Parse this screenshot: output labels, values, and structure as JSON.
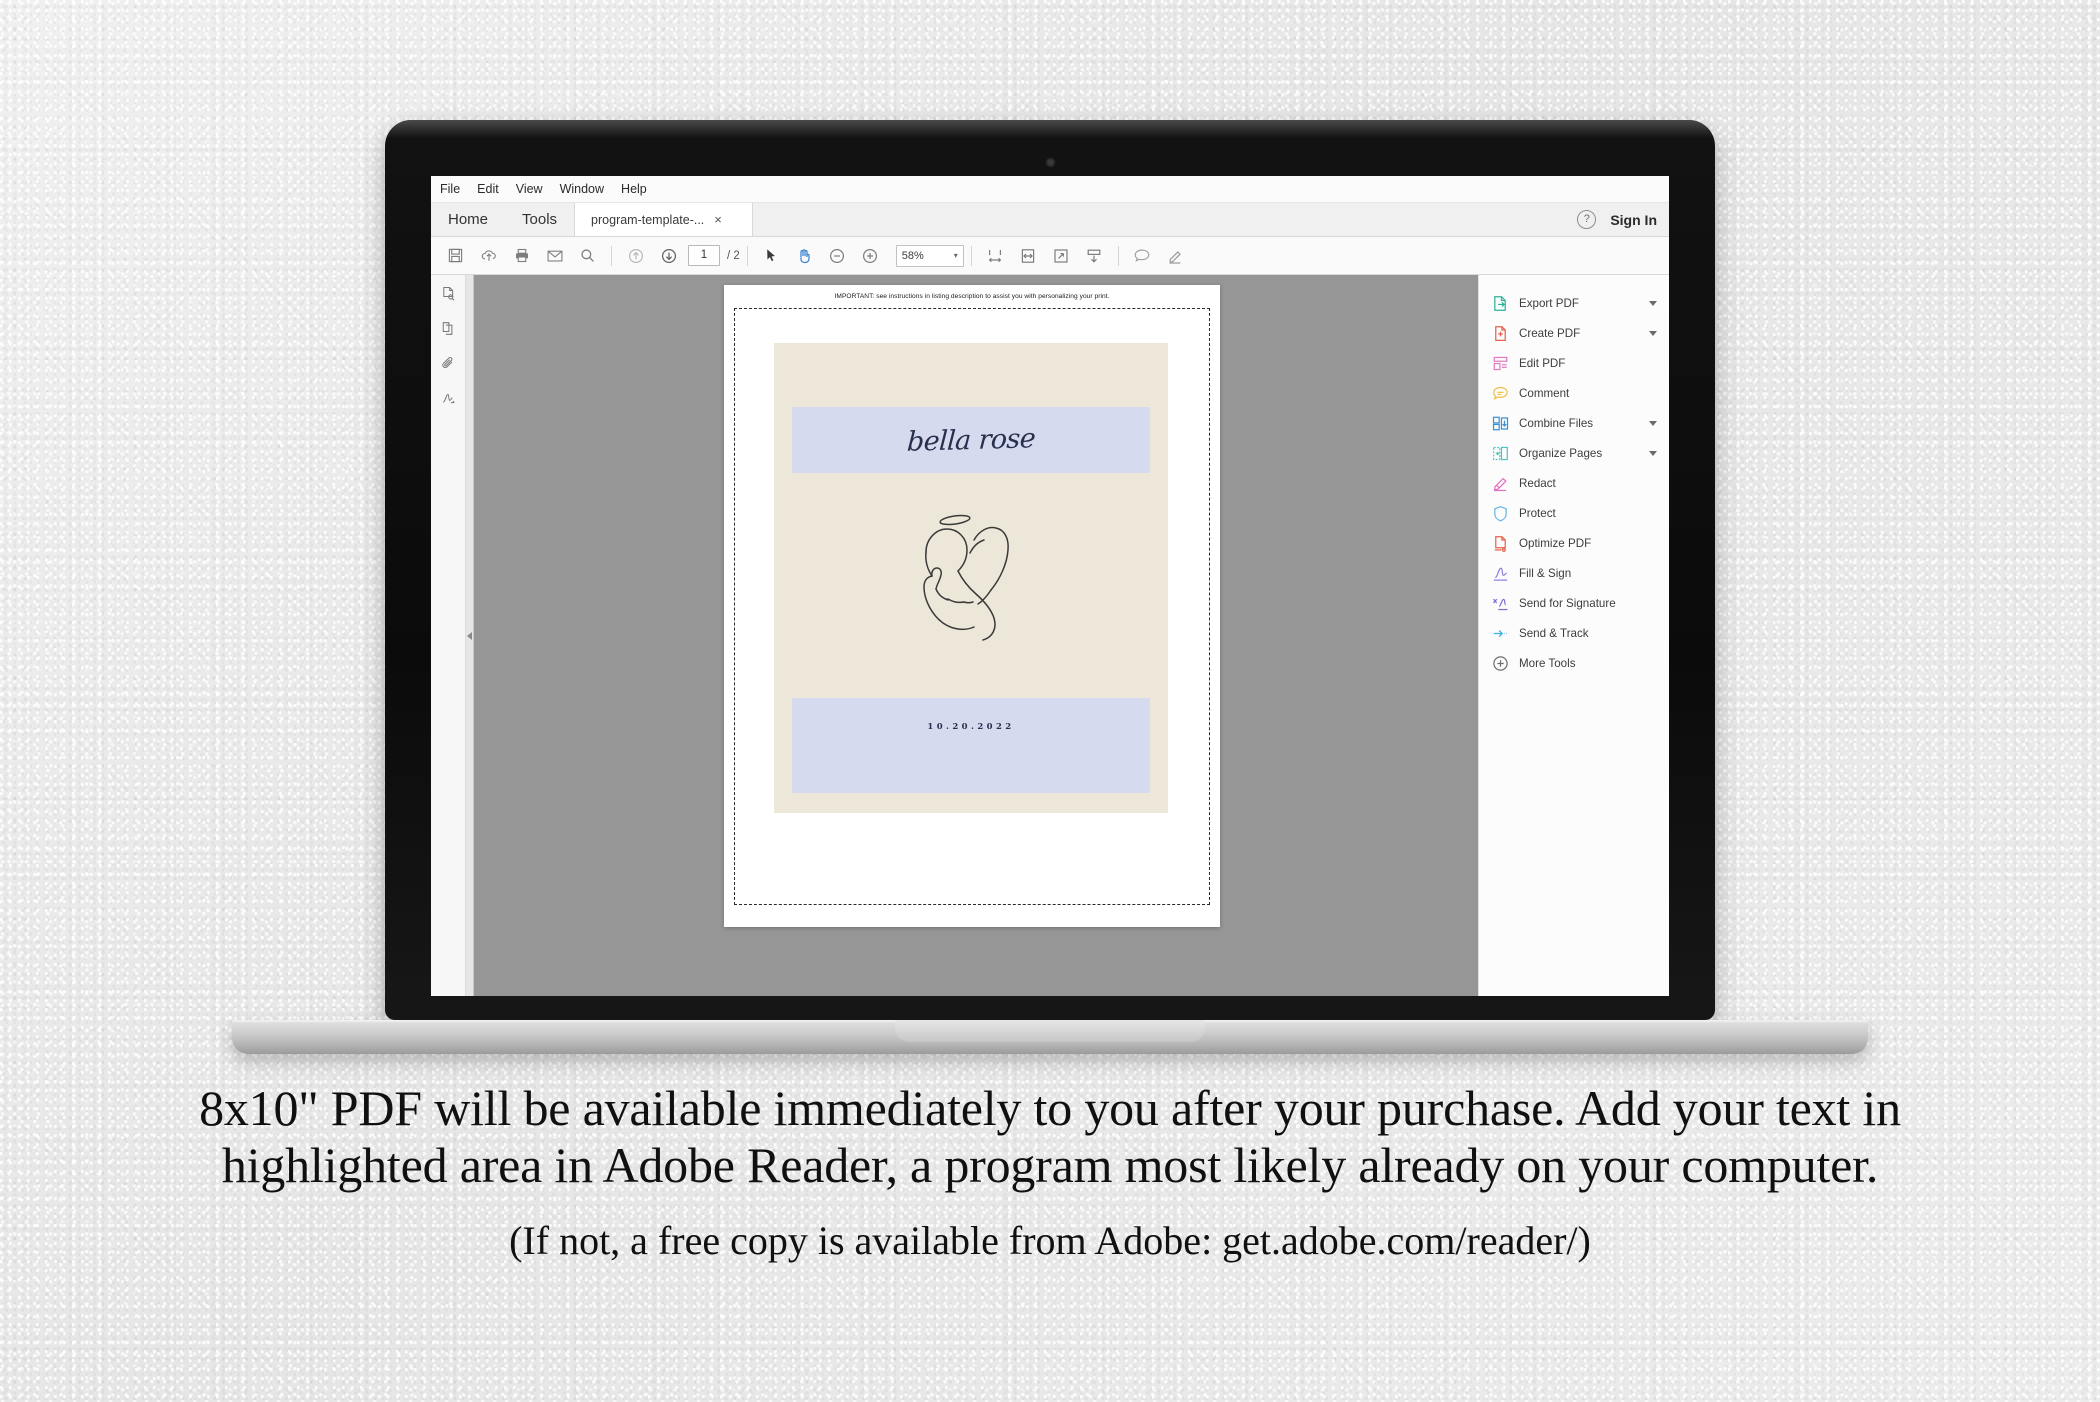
{
  "app": {
    "menubar": [
      "File",
      "Edit",
      "View",
      "Window",
      "Help"
    ],
    "tabs": {
      "home_label": "Home",
      "tools_label": "Tools",
      "document_tab_label": "program-template-...",
      "document_tab_close": "×"
    },
    "account": {
      "help_icon_glyph": "?",
      "sign_in_label": "Sign In"
    },
    "toolbar": {
      "page_current": "1",
      "page_total": "/ 2",
      "zoom_value": "58%",
      "zoom_caret": "▾",
      "icons": [
        "save-icon",
        "upload-cloud-icon",
        "print-icon",
        "email-icon",
        "search-icon",
        "previous-page-icon",
        "next-page-icon",
        "select-tool-icon",
        "hand-tool-icon",
        "zoom-out-icon",
        "zoom-in-icon",
        "fit-width-icon",
        "fit-page-icon",
        "fullscreen-icon",
        "scroll-down-icon",
        "comment-icon",
        "highlight-icon"
      ]
    },
    "left_rail_icons": [
      "page-thumbnails-icon",
      "page-copy-icon",
      "attachments-icon",
      "signature-icon"
    ],
    "collapse_handle": "collapse-left-panel"
  },
  "tools_panel": {
    "items": [
      {
        "label": "Export PDF",
        "icon": "export-pdf-icon",
        "has_caret": true,
        "color": "#2bb29b"
      },
      {
        "label": "Create PDF",
        "icon": "create-pdf-icon",
        "has_caret": true,
        "color": "#e8604c"
      },
      {
        "label": "Edit PDF",
        "icon": "edit-pdf-icon",
        "has_caret": false,
        "color": "#e07bbd"
      },
      {
        "label": "Comment",
        "icon": "comment-bubble-icon",
        "has_caret": false,
        "color": "#efc14a"
      },
      {
        "label": "Combine Files",
        "icon": "combine-files-icon",
        "has_caret": true,
        "color": "#3b8fd4"
      },
      {
        "label": "Organize Pages",
        "icon": "organize-pages-icon",
        "has_caret": true,
        "color": "#4fc4c0"
      },
      {
        "label": "Redact",
        "icon": "redact-marker-icon",
        "has_caret": false,
        "color": "#e36fc0"
      },
      {
        "label": "Protect",
        "icon": "shield-icon",
        "has_caret": false,
        "color": "#67b6e8"
      },
      {
        "label": "Optimize PDF",
        "icon": "optimize-pdf-icon",
        "has_caret": false,
        "color": "#e8604c"
      },
      {
        "label": "Fill & Sign",
        "icon": "fill-and-sign-pen-icon",
        "has_caret": false,
        "color": "#8a7fe0"
      },
      {
        "label": "Send for Signature",
        "icon": "send-for-signature-icon",
        "has_caret": false,
        "color": "#7d6fd6"
      },
      {
        "label": "Send & Track",
        "icon": "send-and-track-icon",
        "has_caret": false,
        "color": "#3fb0e5"
      },
      {
        "label": "More Tools",
        "icon": "more-tools-plus-icon",
        "has_caret": false,
        "color": "#6f6f6f"
      }
    ]
  },
  "document": {
    "instruction_note": "IMPORTANT: see instructions in listing description to assist you with personalizing your print.",
    "name_text": "bella rose",
    "date_text": "10.20.2022",
    "illustration": "sleeping-baby-angel-line-art",
    "colors": {
      "card_background": "#ede7d9",
      "highlight_field": "#d6daef",
      "page_background": "#ffffff",
      "viewer_backdrop": "#969696",
      "ink": "#27304d"
    }
  },
  "caption": {
    "line1": "8x10\" PDF will be available immediately to you after your purchase.  Add your text in",
    "line2": "highlighted area in Adobe Reader, a program most likely already on your computer.",
    "line3": "(If not, a free copy is available from Adobe: get.adobe.com/reader/)"
  }
}
